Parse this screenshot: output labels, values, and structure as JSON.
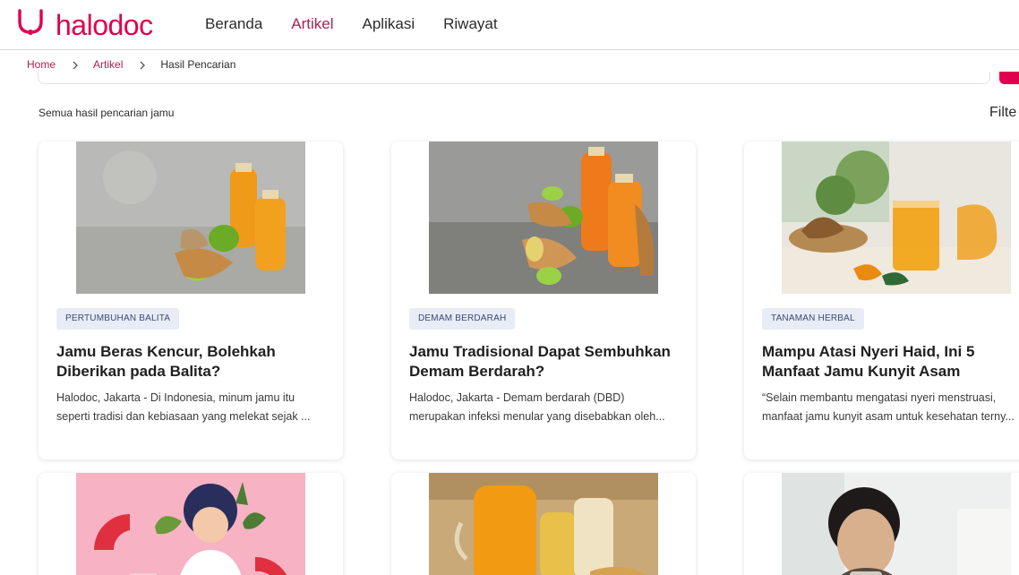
{
  "brand": {
    "name": "halodoc",
    "color": "#e0004d",
    "logo_icon": "stethoscope-icon"
  },
  "nav": [
    {
      "label": "Beranda",
      "active": false
    },
    {
      "label": "Artikel",
      "active": true
    },
    {
      "label": "Aplikasi",
      "active": false
    },
    {
      "label": "Riwayat",
      "active": false
    }
  ],
  "breadcrumb": {
    "home": "Home",
    "artikel": "Artikel",
    "current": "Hasil Pencarian",
    "separator_icon": "chevron-right-icon"
  },
  "results": {
    "label": "Semua hasil pencarian jamu",
    "filter": "Filte"
  },
  "cards": [
    {
      "tag": "PERTUMBUHAN BALITA",
      "title": "Jamu Beras Kencur, Bolehkah Diberikan pada Balita?",
      "excerpt1": "Halodoc, Jakarta - Di Indonesia, minum jamu itu",
      "excerpt2": "seperti tradisi dan kebiasaan yang melekat sejak ..."
    },
    {
      "tag": "DEMAM BERDARAH",
      "title": "Jamu Tradisional Dapat Sembuhkan Demam Berdarah?",
      "excerpt1": "Halodoc, Jakarta - Demam berdarah (DBD)",
      "excerpt2": "merupakan infeksi menular yang disebabkan oleh..."
    },
    {
      "tag": "TANAMAN HERBAL",
      "title": "Mampu Atasi Nyeri Haid, Ini 5 Manfaat Jamu Kunyit Asam",
      "excerpt1": "“Selain membantu mengatasi nyeri menstruasi,",
      "excerpt2": "manfaat jamu kunyit asam untuk kesehatan terny..."
    }
  ],
  "colors": {
    "accent": "#b01e4f",
    "tag_bg": "#e8ecf6",
    "tag_text": "#3b4a74"
  }
}
